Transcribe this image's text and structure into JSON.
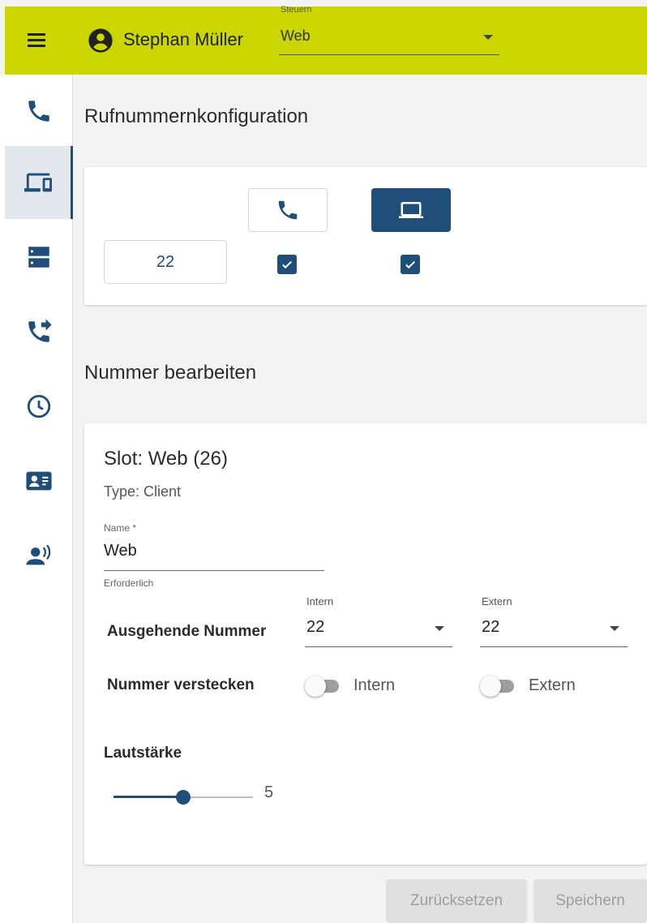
{
  "header": {
    "user_name": "Stephan Müller",
    "control_select": {
      "label": "Steuern",
      "value": "Web"
    }
  },
  "sidebar": {
    "items": [
      {
        "icon": "phone-icon"
      },
      {
        "icon": "devices-icon",
        "active": true
      },
      {
        "icon": "server-icon"
      },
      {
        "icon": "call-forward-icon"
      },
      {
        "icon": "clock-icon"
      },
      {
        "icon": "contact-card-icon"
      },
      {
        "icon": "voice-user-icon"
      }
    ]
  },
  "config": {
    "title": "Rufnummernkonfiguration",
    "number": "22",
    "phone_checked": true,
    "laptop_checked": true
  },
  "edit": {
    "title": "Nummer bearbeiten",
    "slot_title": "Slot: Web (26)",
    "slot_type": "Type: Client",
    "name_label": "Name *",
    "name_value": "Web",
    "name_hint": "Erforderlich",
    "outgoing_label": "Ausgehende Nummer",
    "intern_select": {
      "label": "Intern",
      "value": "22"
    },
    "extern_select": {
      "label": "Extern",
      "value": "22"
    },
    "hide_label": "Nummer verstecken",
    "hide_intern": {
      "label": "Intern",
      "on": false
    },
    "hide_extern": {
      "label": "Extern",
      "on": false
    },
    "volume_label": "Lautstärke",
    "volume_value": "5",
    "volume_fraction": 0.5
  },
  "actions": {
    "reset_label": "Zurücksetzen",
    "save_label": "Speichern"
  },
  "colors": {
    "topbar": "#cbd600",
    "accent": "#1f4e79"
  }
}
